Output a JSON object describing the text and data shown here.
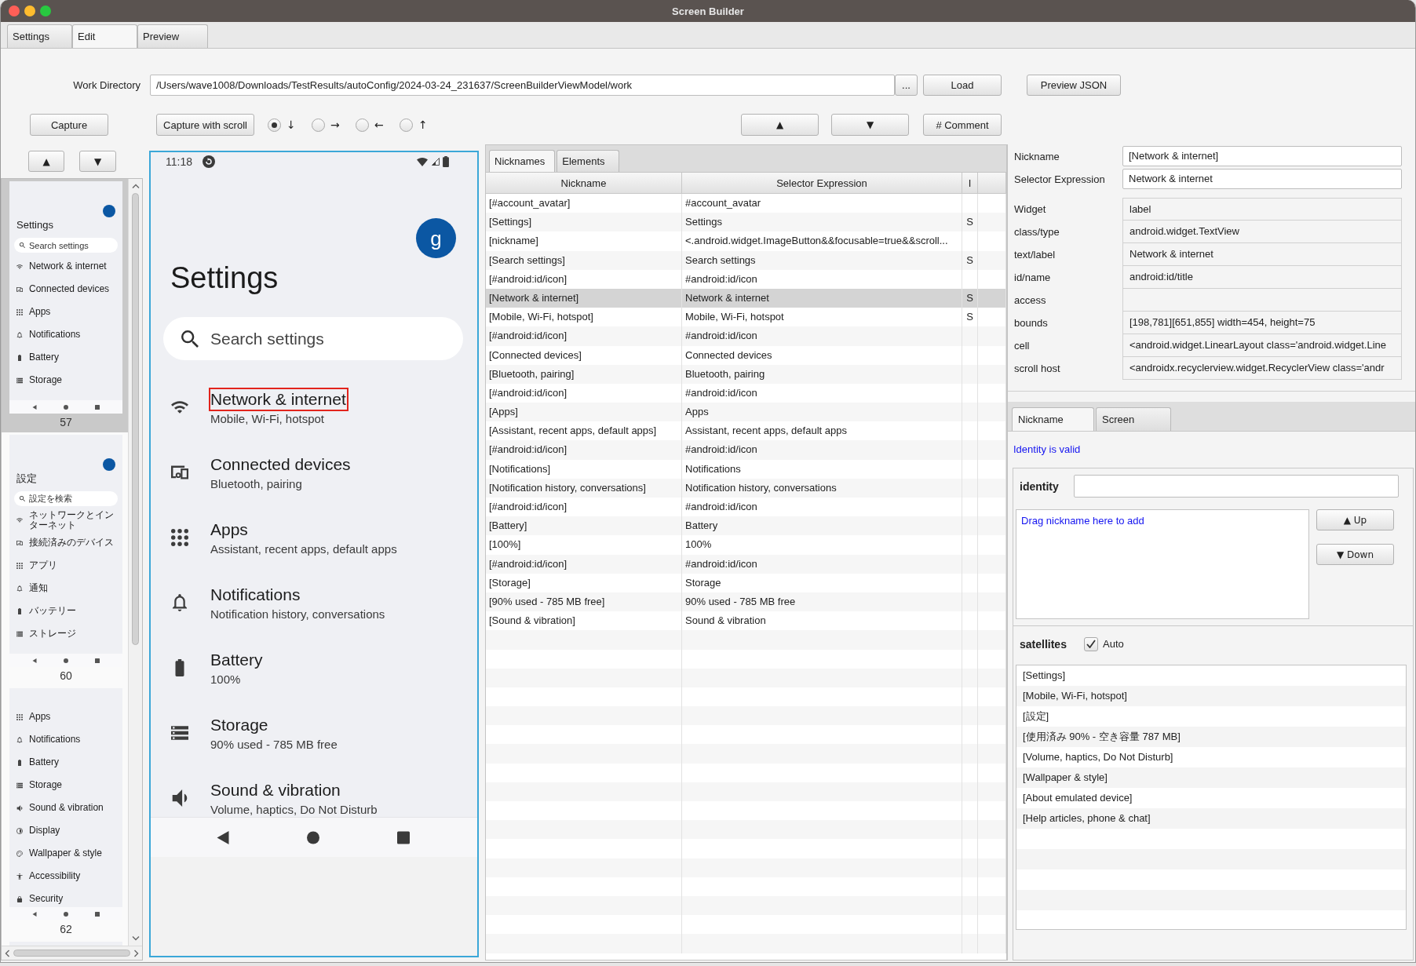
{
  "window": {
    "title": "Screen Builder"
  },
  "main_tabs": [
    {
      "label": "Settings",
      "selected": false
    },
    {
      "label": "Edit",
      "selected": true
    },
    {
      "label": "Preview",
      "selected": false
    }
  ],
  "work_directory": {
    "label": "Work Directory",
    "value": "/Users/wave1008/Downloads/TestResults/autoConfig/2024-03-24_231637/ScreenBuilderViewModel/work",
    "browse_button": "...",
    "load_button": "Load",
    "preview_button": "Preview JSON"
  },
  "capture_toolbar": {
    "capture_button": "Capture",
    "scroll_button": "Capture with scroll",
    "directions": [
      {
        "arrow": "↓",
        "selected": true
      },
      {
        "arrow": "→",
        "selected": false
      },
      {
        "arrow": "←",
        "selected": false
      },
      {
        "arrow": "↑",
        "selected": false
      }
    ],
    "up_button": "▲",
    "down_button": "▼",
    "comment_button": "# Comment"
  },
  "thumbnails": {
    "up_button": "▲",
    "down_button": "▼",
    "items": [
      {
        "number": "57",
        "selected": true,
        "title": "Settings",
        "search_placeholder": "Search settings",
        "rows": [
          {
            "kind": "network",
            "title": "Network & internet"
          },
          {
            "kind": "devices",
            "title": "Connected devices"
          },
          {
            "kind": "apps",
            "title": "Apps"
          },
          {
            "kind": "notifications",
            "title": "Notifications"
          },
          {
            "kind": "battery",
            "title": "Battery"
          },
          {
            "kind": "storage",
            "title": "Storage"
          }
        ]
      },
      {
        "number": "60",
        "selected": false,
        "title": "設定",
        "search_placeholder": "設定を検索",
        "rows": [
          {
            "kind": "network",
            "title": "ネットワークとインターネット"
          },
          {
            "kind": "devices",
            "title": "接続済みのデバイス"
          },
          {
            "kind": "apps",
            "title": "アプリ"
          },
          {
            "kind": "notifications",
            "title": "通知"
          },
          {
            "kind": "battery",
            "title": "バッテリー"
          },
          {
            "kind": "storage",
            "title": "ストレージ"
          }
        ]
      },
      {
        "number": "62",
        "selected": false,
        "rows": [
          {
            "kind": "apps",
            "title": "Apps"
          },
          {
            "kind": "notifications",
            "title": "Notifications"
          },
          {
            "kind": "battery",
            "title": "Battery"
          },
          {
            "kind": "storage",
            "title": "Storage"
          },
          {
            "kind": "sound",
            "title": "Sound & vibration"
          },
          {
            "kind": "display",
            "title": "Display"
          },
          {
            "kind": "wallpaper",
            "title": "Wallpaper & style"
          },
          {
            "kind": "accessibility",
            "title": "Accessibility"
          },
          {
            "kind": "security",
            "title": "Security"
          }
        ]
      },
      {
        "selected": false
      }
    ]
  },
  "device_screen": {
    "time": "11:18",
    "avatar": "g",
    "title": "Settings",
    "search_placeholder": "Search settings",
    "rows": [
      {
        "kind": "network",
        "title": "Network & internet",
        "subtitle": "Mobile, Wi-Fi, hotspot",
        "highlighted": true
      },
      {
        "kind": "devices",
        "title": "Connected devices",
        "subtitle": "Bluetooth, pairing",
        "highlighted": false
      },
      {
        "kind": "apps",
        "title": "Apps",
        "subtitle": "Assistant, recent apps, default apps",
        "highlighted": false
      },
      {
        "kind": "notifications",
        "title": "Notifications",
        "subtitle": "Notification history, conversations",
        "highlighted": false
      },
      {
        "kind": "battery",
        "title": "Battery",
        "subtitle": "100%",
        "highlighted": false
      },
      {
        "kind": "storage",
        "title": "Storage",
        "subtitle": "90% used - 785 MB free",
        "highlighted": false
      },
      {
        "kind": "sound",
        "title": "Sound & vibration",
        "subtitle": "Volume, haptics, Do Not Disturb",
        "highlighted": false
      }
    ]
  },
  "nickname_table": {
    "tabs": [
      {
        "label": "Nicknames",
        "selected": true
      },
      {
        "label": "Elements",
        "selected": false
      }
    ],
    "columns": [
      "Nickname",
      "Selector Expression",
      "I"
    ],
    "rows": [
      {
        "nickname": "[#account_avatar]",
        "selector": "#account_avatar",
        "selected": false
      },
      {
        "nickname": "[Settings]",
        "selector": "Settings",
        "column_3": "S",
        "selected": false
      },
      {
        "nickname": "[nickname]",
        "selector": "<.android.widget.ImageButton&&focusable=true&&scroll...",
        "selected": false
      },
      {
        "nickname": "[Search settings]",
        "selector": "Search settings",
        "column_3": "S",
        "selected": false
      },
      {
        "nickname": "[#android:id/icon]",
        "selector": "#android:id/icon",
        "selected": false
      },
      {
        "nickname": "[Network & internet]",
        "selector": "Network & internet",
        "column_3": "S",
        "selected": true
      },
      {
        "nickname": "[Mobile, Wi-Fi, hotspot]",
        "selector": "Mobile, Wi-Fi, hotspot",
        "column_3": "S",
        "selected": false
      },
      {
        "nickname": "[#android:id/icon]",
        "selector": "#android:id/icon",
        "selected": false
      },
      {
        "nickname": "[Connected devices]",
        "selector": "Connected devices",
        "selected": false
      },
      {
        "nickname": "[Bluetooth, pairing]",
        "selector": "Bluetooth, pairing",
        "selected": false
      },
      {
        "nickname": "[#android:id/icon]",
        "selector": "#android:id/icon",
        "selected": false
      },
      {
        "nickname": "[Apps]",
        "selector": "Apps",
        "selected": false
      },
      {
        "nickname": "[Assistant, recent apps, default apps]",
        "selector": "Assistant, recent apps, default apps",
        "selected": false
      },
      {
        "nickname": "[#android:id/icon]",
        "selector": "#android:id/icon",
        "selected": false
      },
      {
        "nickname": "[Notifications]",
        "selector": "Notifications",
        "selected": false
      },
      {
        "nickname": "[Notification history, conversations]",
        "selector": "Notification history, conversations",
        "selected": false
      },
      {
        "nickname": "[#android:id/icon]",
        "selector": "#android:id/icon",
        "selected": false
      },
      {
        "nickname": "[Battery]",
        "selector": "Battery",
        "selected": false
      },
      {
        "nickname": "[100%]",
        "selector": "100%",
        "selected": false
      },
      {
        "nickname": "[#android:id/icon]",
        "selector": "#android:id/icon",
        "selected": false
      },
      {
        "nickname": "[Storage]",
        "selector": "Storage",
        "selected": false
      },
      {
        "nickname": "[90% used - 785 MB free]",
        "selector": "90% used - 785 MB free",
        "selected": false
      },
      {
        "nickname": "[Sound & vibration]",
        "selector": "Sound & vibration",
        "selected": false
      }
    ]
  },
  "element_details": {
    "nickname": {
      "label": "Nickname",
      "value": "[Network & internet]"
    },
    "selector": {
      "label": "Selector Expression",
      "value": "Network & internet"
    },
    "attributes": [
      {
        "label": "Widget",
        "value": "label"
      },
      {
        "label": "class/type",
        "value": "android.widget.TextView"
      },
      {
        "label": "text/label",
        "value": "Network & internet"
      },
      {
        "label": "id/name",
        "value": "android:id/title"
      },
      {
        "label": "access"
      },
      {
        "label": "bounds",
        "value": "[198,781][651,855] width=454, height=75"
      },
      {
        "label": "cell",
        "value": "<android.widget.LinearLayout class='android.widget.Line"
      },
      {
        "label": "scroll host",
        "value": "<androidx.recyclerview.widget.RecyclerView class='andr"
      }
    ]
  },
  "detail_tabs": [
    {
      "label": "Nickname",
      "selected": true
    },
    {
      "label": "Screen",
      "selected": false
    }
  ],
  "identity": {
    "status": "Identity is valid",
    "label": "identity",
    "drop_hint": "Drag nickname here to add",
    "up_button": "▲ Up",
    "down_button": "▼ Down"
  },
  "satellites": {
    "label": "satellites",
    "auto": {
      "label": "Auto",
      "checked": true
    },
    "items": [
      "[Settings]",
      "[Mobile, Wi-Fi, hotspot]",
      "[設定]",
      "[使用済み 90% - 空き容量 787 MB]",
      "[Volume, haptics, Do Not Disturb]",
      "[Wallpaper & style]",
      "[About emulated device]",
      "[Help articles, phone & chat]"
    ]
  }
}
